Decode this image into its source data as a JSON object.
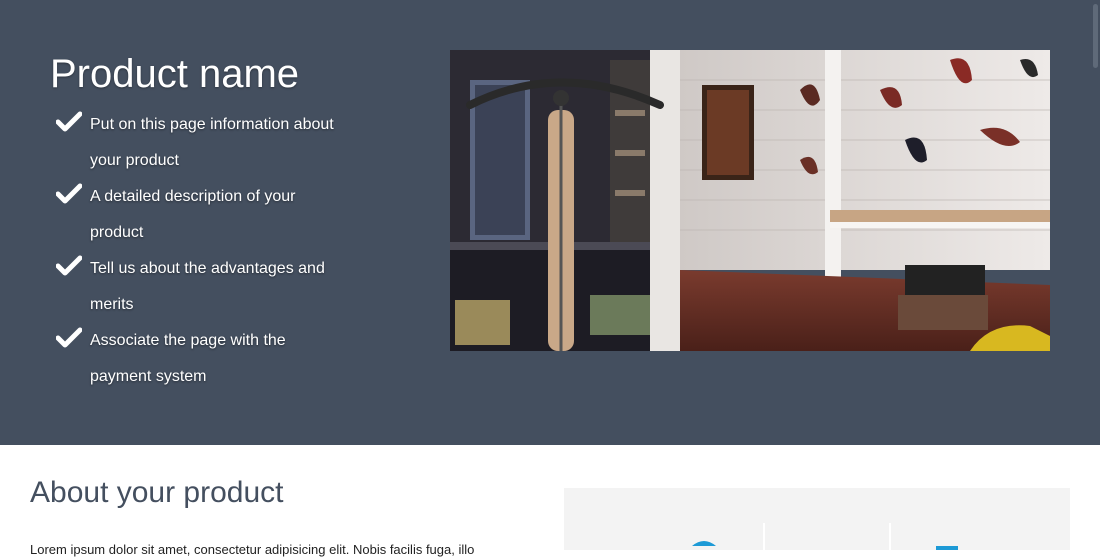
{
  "hero": {
    "title": "Product name",
    "features": [
      {
        "line1": "Put on this page information about",
        "line2": "your product"
      },
      {
        "line1": "A detailed description of your",
        "line2": "product"
      },
      {
        "line1": "Tell us about the advantages and",
        "line2": "merits"
      },
      {
        "line1": "Associate the page with the",
        "line2": "payment system"
      }
    ],
    "check_icon": "checkmark-icon",
    "image_subject": "bicycle-shop-photo"
  },
  "about": {
    "title": "About your product",
    "text": "Lorem ipsum dolor sit amet, consectetur adipisicing elit. Nobis facilis fuga, illo",
    "image_subject": "product-photo"
  },
  "colors": {
    "hero_background": "#444f5f",
    "about_title": "#444f5f",
    "page_background": "#ffffff"
  }
}
